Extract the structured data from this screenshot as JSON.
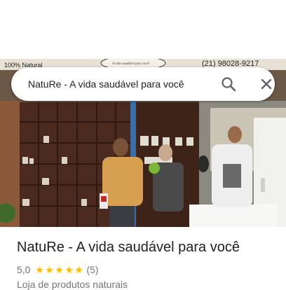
{
  "search": {
    "query": "NatuRe - A vida saudável para você"
  },
  "photo": {
    "banner_left": "100% Natural",
    "banner_center": "A vida saudável para você",
    "banner_phone": "(21) 98028-9217"
  },
  "place": {
    "title": "NatuRe - A vida saudável para você",
    "rating": "5,0",
    "stars": 5,
    "review_count": "(5)",
    "category": "Loja de produtos naturais"
  },
  "colors": {
    "star": "#fbbc04",
    "title": "#202124",
    "secondary": "#70757a"
  }
}
